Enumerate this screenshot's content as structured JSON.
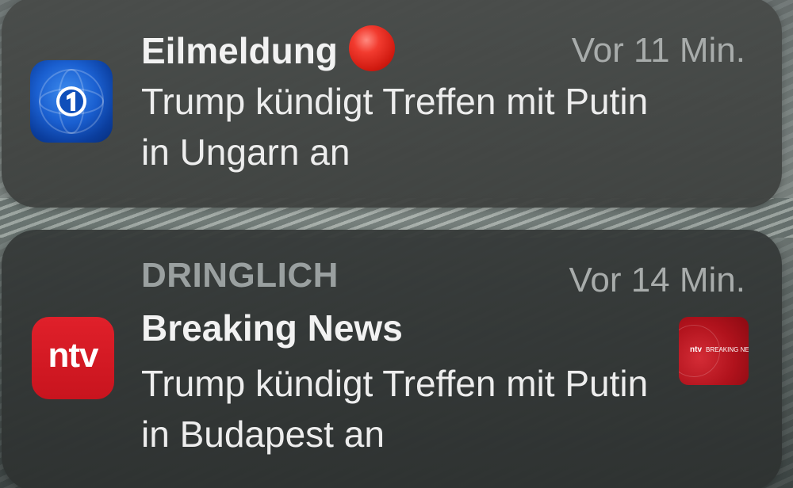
{
  "notifications": [
    {
      "app_icon": "tagesschau-icon",
      "title": "Eilmeldung",
      "title_emoji": "red-circle-emoji",
      "time": "Vor 11 Min.",
      "body": "Trump kündigt Treffen mit Putin in Ungarn an"
    },
    {
      "app_icon": "ntv-icon",
      "app_icon_text": "ntv",
      "header": "DRINGLICH",
      "title": "Breaking News",
      "time": "Vor 14 Min.",
      "body": "Trump kündigt Treffen mit Putin in Budapest an",
      "thumbnail": {
        "logo": "ntv",
        "caption": "BREAKING NE"
      }
    }
  ],
  "colors": {
    "tagesschau_blue": "#1a5fd0",
    "ntv_red": "#e0202a",
    "red_dot": "#f23b2f",
    "card_bg": "#3a3d3c"
  }
}
